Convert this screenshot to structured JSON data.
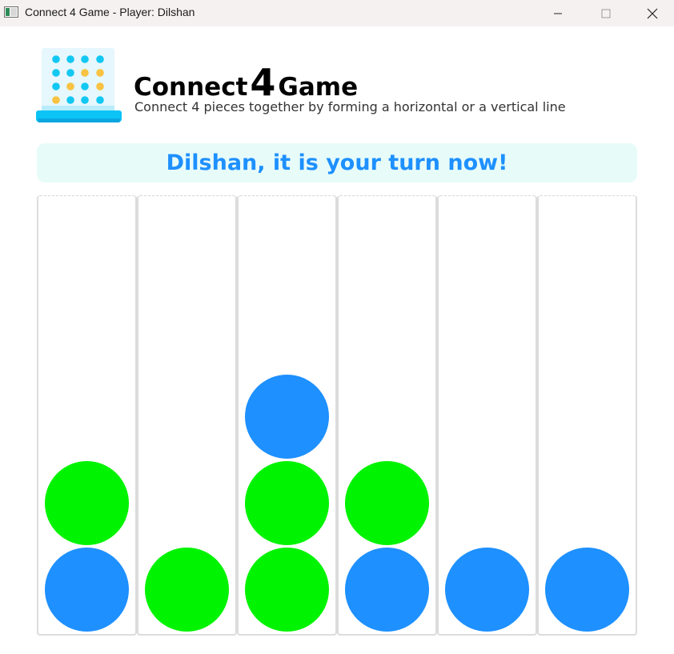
{
  "window": {
    "title": "Connect 4 Game - Player: Dilshan",
    "controls": [
      "minimize-icon",
      "maximize-icon",
      "close-icon"
    ]
  },
  "header": {
    "title_before": "Connect",
    "title_number": "4",
    "title_after": "Game",
    "subtitle": "Connect 4 pieces together by forming a horizontal or a vertical line",
    "logo_icon": "connect-four-board-icon"
  },
  "status": {
    "message": "Dilshan, it is your turn now!"
  },
  "colors": {
    "blue_disc": "#1e90ff",
    "green_disc": "#00f300",
    "banner_bg": "#e7fcf9",
    "banner_text": "#1e90ff"
  },
  "board": {
    "columns": 6,
    "columns_pieces_bottom_up": [
      [
        "blue",
        "green"
      ],
      [
        "green"
      ],
      [
        "green",
        "green",
        "blue"
      ],
      [
        "blue",
        "green"
      ],
      [
        "blue"
      ],
      [
        "blue"
      ]
    ]
  }
}
